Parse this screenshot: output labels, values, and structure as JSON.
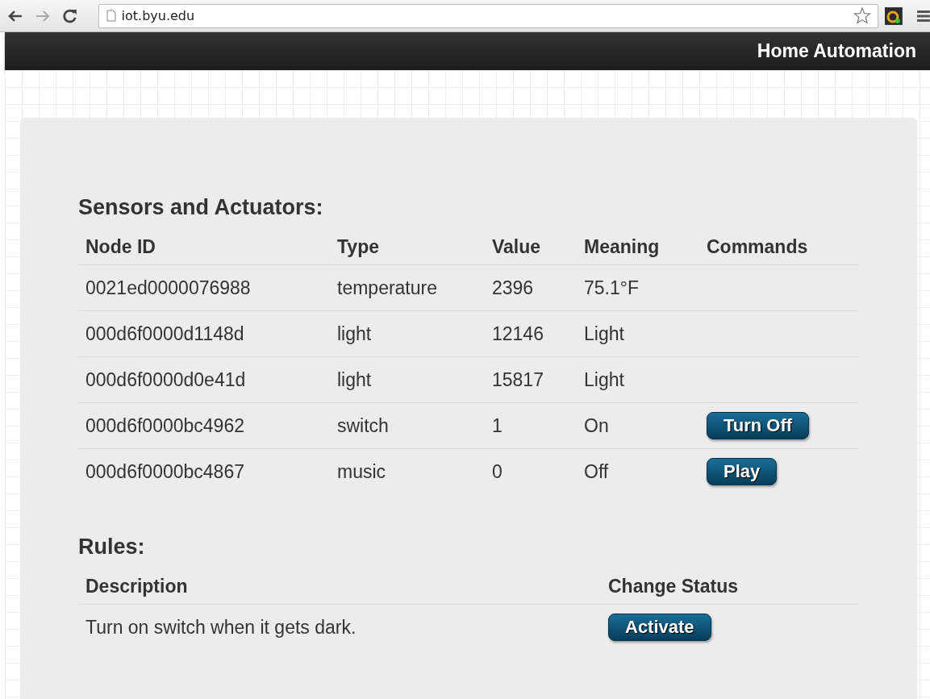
{
  "browser": {
    "url": "iot.byu.edu"
  },
  "header": {
    "title": "Home Automation"
  },
  "sensors": {
    "title": "Sensors and Actuators:",
    "columns": [
      "Node ID",
      "Type",
      "Value",
      "Meaning",
      "Commands"
    ],
    "rows": [
      {
        "node_id": "0021ed0000076988",
        "type": "temperature",
        "value": "2396",
        "meaning": "75.1°F"
      },
      {
        "node_id": "000d6f0000d1148d",
        "type": "light",
        "value": "12146",
        "meaning": "Light"
      },
      {
        "node_id": "000d6f0000d0e41d",
        "type": "light",
        "value": "15817",
        "meaning": "Light"
      },
      {
        "node_id": "000d6f0000bc4962",
        "type": "switch",
        "value": "1",
        "meaning": "On",
        "command": "Turn Off"
      },
      {
        "node_id": "000d6f0000bc4867",
        "type": "music",
        "value": "0",
        "meaning": "Off",
        "command": "Play"
      }
    ]
  },
  "rules": {
    "title": "Rules:",
    "columns": [
      "Description",
      "Change Status"
    ],
    "rows": [
      {
        "description": "Turn on switch when it gets dark.",
        "command": "Activate"
      }
    ]
  }
}
